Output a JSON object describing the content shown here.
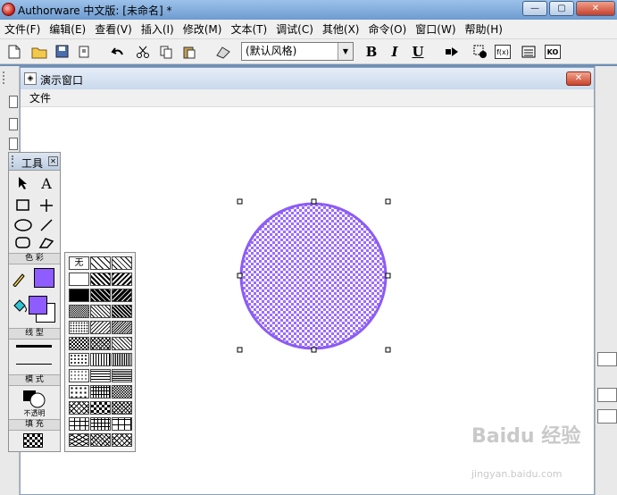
{
  "window": {
    "title": "Authorware 中文版: [未命名] *",
    "buttons": {
      "minimize": "—",
      "maximize": "▢",
      "close": "✕"
    }
  },
  "menubar": {
    "items": [
      "文件(F)",
      "编辑(E)",
      "查看(V)",
      "插入(I)",
      "修改(M)",
      "文本(T)",
      "调试(C)",
      "其他(X)",
      "命令(O)",
      "窗口(W)",
      "帮助(H)"
    ]
  },
  "toolbar": {
    "font_style": "(默认风格)",
    "bold": "B",
    "italic": "I",
    "underline": "U",
    "labels": {
      "f_label": "f(x)",
      "ko_label": "KO"
    }
  },
  "presentation": {
    "title": "演示窗口",
    "menu": "文件",
    "close": "✕"
  },
  "tools": {
    "title": "工具",
    "close": "✕",
    "section_color": "色 彩",
    "section_line": "线 型",
    "section_mode": "模 式",
    "mode_value": "不透明",
    "section_fill": "填 充",
    "text_tool": "A"
  },
  "patterns": {
    "none_label": "无"
  },
  "colors": {
    "circle_fill": "#9b6cff",
    "circle_stroke": "#8c5cf5",
    "fill_swatch": "#8f5cff"
  },
  "watermark": {
    "brand": "Baidu 经验",
    "url": "jingyan.baidu.com"
  }
}
